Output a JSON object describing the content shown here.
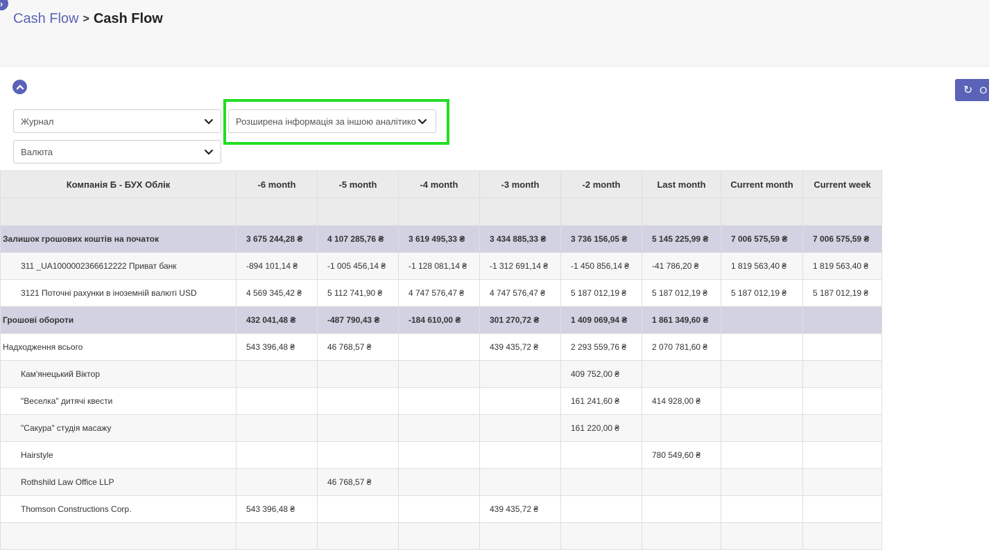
{
  "breadcrumb": {
    "parent": "Cash Flow",
    "separator": ">",
    "current": "Cash Flow"
  },
  "toolbar": {
    "refresh_label": "O"
  },
  "filters": {
    "journal": "Журнал",
    "extended": "Розширена інформація за іншою аналітико",
    "currency": "Валюта"
  },
  "table": {
    "company": "Компанія Б - БУХ Облік",
    "columns": [
      "-6 month",
      "-5 month",
      "-4 month",
      "-3 month",
      "-2 month",
      "Last month",
      "Current month",
      "Current week"
    ],
    "rows": [
      {
        "label": "Залишок грошових коштів на початок",
        "kind": "group",
        "cells": [
          "3 675 244,28 ₴",
          "4 107 285,76 ₴",
          "3 619 495,33 ₴",
          "3 434 885,33 ₴",
          "3 736 156,05 ₴",
          "5 145 225,99 ₴",
          "7 006 575,59 ₴",
          "7 006 575,59 ₴"
        ]
      },
      {
        "label": "311 _UA1000002366612222 Приват банк",
        "kind": "alt",
        "indent": true,
        "cells": [
          "-894 101,14 ₴",
          "-1 005 456,14 ₴",
          "-1 128 081,14 ₴",
          "-1 312 691,14 ₴",
          "-1 450 856,14 ₴",
          "-41 786,20 ₴",
          "1 819 563,40 ₴",
          "1 819 563,40 ₴"
        ]
      },
      {
        "label": "3121 Поточні рахунки в іноземній валюті USD",
        "kind": "white",
        "indent": true,
        "cells": [
          "4 569 345,42 ₴",
          "5 112 741,90 ₴",
          "4 747 576,47 ₴",
          "4 747 576,47 ₴",
          "5 187 012,19 ₴",
          "5 187 012,19 ₴",
          "5 187 012,19 ₴",
          "5 187 012,19 ₴"
        ]
      },
      {
        "label": "Грошові обороти",
        "kind": "group",
        "cells": [
          "432 041,48 ₴",
          "-487 790,43 ₴",
          "-184 610,00 ₴",
          "301 270,72 ₴",
          "1 409 069,94 ₴",
          "1 861 349,60 ₴",
          "",
          ""
        ]
      },
      {
        "label": "Надходження всього",
        "kind": "white",
        "cells": [
          "543 396,48 ₴",
          "46 768,57 ₴",
          "",
          "439 435,72 ₴",
          "2 293 559,76 ₴",
          "2 070 781,60 ₴",
          "",
          ""
        ]
      },
      {
        "label": "Кам'янецький Віктор",
        "kind": "alt",
        "indent": true,
        "cells": [
          "",
          "",
          "",
          "",
          "409 752,00 ₴",
          "",
          "",
          ""
        ]
      },
      {
        "label": "\"Веселка\" дитячі квести",
        "kind": "white",
        "indent": true,
        "cells": [
          "",
          "",
          "",
          "",
          "161 241,60 ₴",
          "414 928,00 ₴",
          "",
          ""
        ]
      },
      {
        "label": "\"Сакура\" студія масажу",
        "kind": "alt",
        "indent": true,
        "cells": [
          "",
          "",
          "",
          "",
          "161 220,00 ₴",
          "",
          "",
          ""
        ]
      },
      {
        "label": "Hairstyle",
        "kind": "white",
        "indent": true,
        "cells": [
          "",
          "",
          "",
          "",
          "",
          "780 549,60 ₴",
          "",
          ""
        ]
      },
      {
        "label": "Rothshild Law Office LLP",
        "kind": "alt",
        "indent": true,
        "cells": [
          "",
          "46 768,57 ₴",
          "",
          "",
          "",
          "",
          "",
          ""
        ]
      },
      {
        "label": "Thomson Constructions Corp.",
        "kind": "white",
        "indent": true,
        "cells": [
          "543 396,48 ₴",
          "",
          "",
          "439 435,72 ₴",
          "",
          "",
          "",
          ""
        ]
      },
      {
        "label": "",
        "kind": "alt",
        "indent": true,
        "cells": [
          "",
          "",
          "",
          "",
          "",
          "",
          "",
          ""
        ]
      }
    ]
  }
}
